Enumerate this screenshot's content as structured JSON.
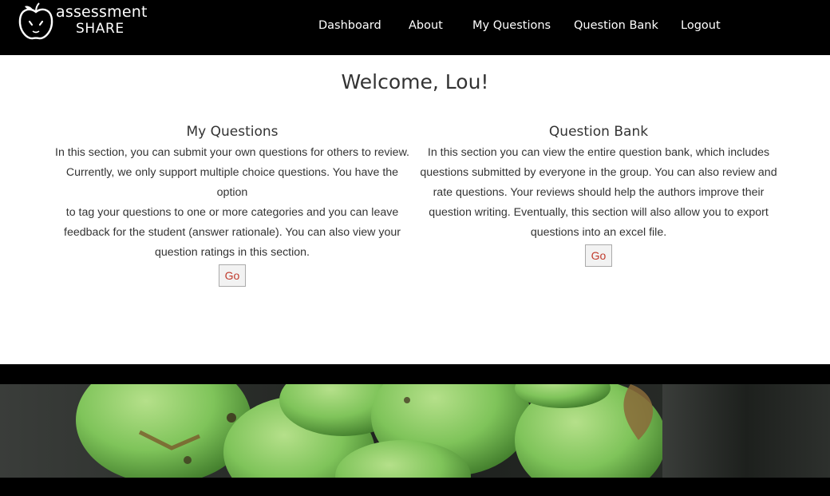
{
  "brand": {
    "line1": "assessment",
    "line2": "SHARE",
    "icon": "apple-icon"
  },
  "nav": {
    "items": [
      {
        "label": "Dashboard"
      },
      {
        "label": "About"
      },
      {
        "label": "My Questions"
      },
      {
        "label": "Question Bank"
      },
      {
        "label": "Logout"
      }
    ]
  },
  "welcome": "Welcome, Lou!",
  "sections": [
    {
      "title": "My Questions",
      "lines": [
        "In this section, you can submit your own questions for others to review.",
        "Currently, we only support multiple choice questions. You have the option",
        "to tag your questions to one or more categories and you can leave",
        "feedback for the student (answer rationale). You can also view your",
        "question ratings in this section."
      ],
      "button": "Go"
    },
    {
      "title": "Question Bank",
      "lines": [
        "In this section you can view the entire question bank, which includes",
        "questions submitted by everyone in the group. You can also review and",
        "rate questions. Your reviews should help the authors improve their",
        "question writing. Eventually, this section will also allow you to export",
        "questions into an excel file."
      ],
      "button": "Go"
    }
  ],
  "colors": {
    "header_bg": "#000000",
    "go_text": "#c0392b",
    "apple_green": "#7fc45a"
  }
}
